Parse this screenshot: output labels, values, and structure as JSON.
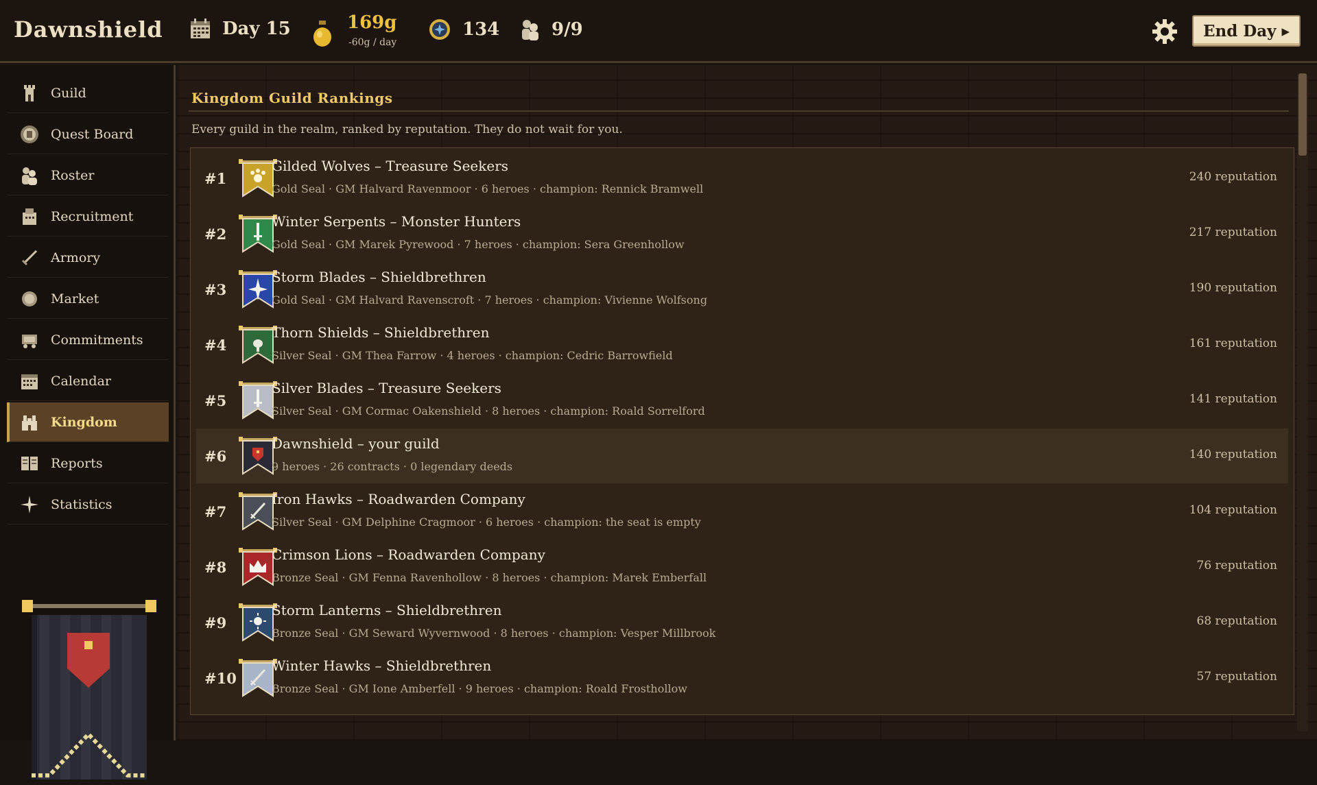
{
  "app": {
    "title": "Dawnshield"
  },
  "topbar": {
    "day": "Day 15",
    "gold": "169g",
    "gold_rate": "-60g / day",
    "renown": "134",
    "heroes": "9/9",
    "end_day_label": "End Day ▸"
  },
  "sidebar": {
    "items": [
      {
        "label": "Guild",
        "icon": "tower-icon"
      },
      {
        "label": "Quest Board",
        "icon": "quest-seal-icon"
      },
      {
        "label": "Roster",
        "icon": "people-icon"
      },
      {
        "label": "Recruitment",
        "icon": "recruit-icon"
      },
      {
        "label": "Armory",
        "icon": "sword-icon"
      },
      {
        "label": "Market",
        "icon": "coin-icon"
      },
      {
        "label": "Commitments",
        "icon": "cart-icon"
      },
      {
        "label": "Calendar",
        "icon": "calendar-icon"
      },
      {
        "label": "Kingdom",
        "icon": "castle-icon",
        "active": true
      },
      {
        "label": "Reports",
        "icon": "book-icon"
      },
      {
        "label": "Statistics",
        "icon": "star-icon"
      }
    ]
  },
  "main": {
    "title": "Kingdom Guild Rankings",
    "subtitle": "Every guild in the realm, ranked by reputation. They do not wait for you.",
    "rankings": [
      {
        "rank": "#1",
        "name": "Gilded Wolves – Treasure Seekers",
        "meta": "Gold Seal · GM Halvard Ravenmoor · 6 heroes · champion: Rennick Bramwell",
        "reputation": "240 reputation",
        "banner_color": "#c9a22a",
        "emblem": "paw"
      },
      {
        "rank": "#2",
        "name": "Winter Serpents – Monster Hunters",
        "meta": "Gold Seal · GM Marek Pyrewood · 7 heroes · champion: Sera Greenhollow",
        "reputation": "217 reputation",
        "banner_color": "#2f8a4a",
        "emblem": "blade"
      },
      {
        "rank": "#3",
        "name": "Storm Blades – Shieldbrethren",
        "meta": "Gold Seal · GM Halvard Ravenscroft · 7 heroes · champion: Vivienne Wolfsong",
        "reputation": "190 reputation",
        "banner_color": "#2a46a8",
        "emblem": "star"
      },
      {
        "rank": "#4",
        "name": "Thorn Shields – Shieldbrethren",
        "meta": "Silver Seal · GM Thea Farrow · 4 heroes · champion: Cedric Barrowfield",
        "reputation": "161 reputation",
        "banner_color": "#2e6a3a",
        "emblem": "bird"
      },
      {
        "rank": "#5",
        "name": "Silver Blades – Treasure Seekers",
        "meta": "Silver Seal · GM Cormac Oakenshield · 8 heroes · champion: Roald Sorrelford",
        "reputation": "141 reputation",
        "banner_color": "#b8bcc4",
        "emblem": "blade"
      },
      {
        "rank": "#6",
        "name": "Dawnshield – your guild",
        "meta": "9 heroes · 26 contracts · 0 legendary deeds",
        "reputation": "140 reputation",
        "banner_color": "#2a2a36",
        "emblem": "shield",
        "is_player": true
      },
      {
        "rank": "#7",
        "name": "Iron Hawks – Roadwarden Company",
        "meta": "Silver Seal · GM Delphine Cragmoor · 6 heroes · champion: the seat is empty",
        "reputation": "104 reputation",
        "banner_color": "#4a4e56",
        "emblem": "sword"
      },
      {
        "rank": "#8",
        "name": "Crimson Lions – Roadwarden Company",
        "meta": "Bronze Seal · GM Fenna Ravenhollow · 8 heroes · champion: Marek Emberfall",
        "reputation": "76 reputation",
        "banner_color": "#a8282a",
        "emblem": "crown"
      },
      {
        "rank": "#9",
        "name": "Storm Lanterns – Shieldbrethren",
        "meta": "Bronze Seal · GM Seward Wyvernwood · 8 heroes · champion: Vesper Millbrook",
        "reputation": "68 reputation",
        "banner_color": "#2c4a70",
        "emblem": "sun"
      },
      {
        "rank": "#10",
        "name": "Winter Hawks – Shieldbrethren",
        "meta": "Bronze Seal · GM Ione Amberfell · 9 heroes · champion: Roald Frosthollow",
        "reputation": "57 reputation",
        "banner_color": "#a8b4c8",
        "emblem": "sword"
      }
    ]
  },
  "colors": {
    "accent_gold": "#f0c96a",
    "active_nav": "#5b4126",
    "gold_text": "#f0c040"
  }
}
